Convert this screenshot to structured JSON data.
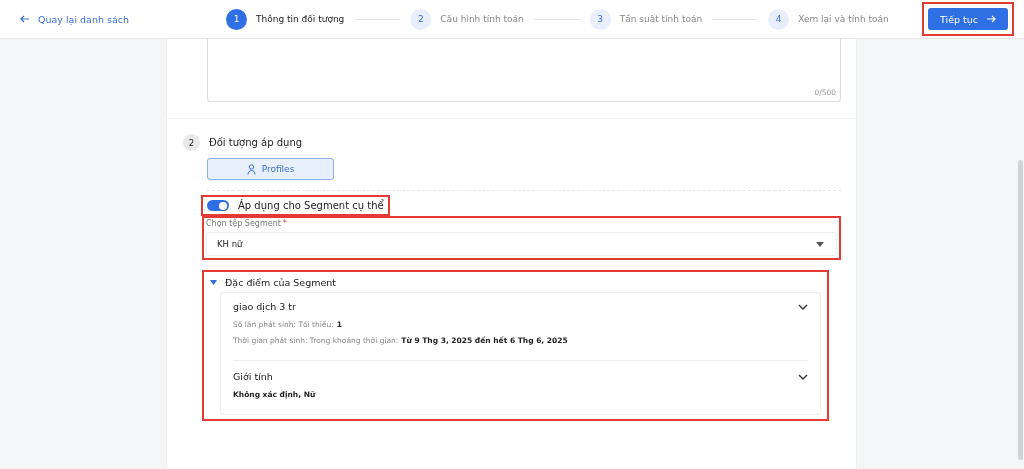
{
  "header": {
    "back_link": "Quay lại danh sách",
    "steps": [
      {
        "number": "1",
        "label": "Thông tin đối tượng",
        "selected": true
      },
      {
        "number": "2",
        "label": "Cấu hình tính toán",
        "selected": false
      },
      {
        "number": "3",
        "label": "Tần suất tính toán",
        "selected": false
      },
      {
        "number": "4",
        "label": "Xem lại và tính toán",
        "selected": false
      }
    ],
    "next_button": {
      "label": "Tiếp tục",
      "highlighted": true
    }
  },
  "description": {
    "counter": "0/500"
  },
  "section": {
    "number": "2",
    "title": "Đối tượng áp dụng",
    "profiles_button": {
      "label": "Profiles",
      "selected": true
    },
    "segment_toggle": {
      "label": "Áp dụng cho Segment cụ thể",
      "on": true,
      "highlighted": true
    },
    "segment_select": {
      "label": "Chọn tệp Segment",
      "required_mark": "*",
      "value": "KH nữ",
      "highlighted": true
    },
    "characteristics": {
      "title": "Đặc điểm của Segment",
      "expanded": true,
      "highlighted": true,
      "items": [
        {
          "title": "giao dịch 3 tr",
          "lines": [
            {
              "label": "Số lần phát sinh: Tối thiểu:",
              "value": "1"
            },
            {
              "label": "Thời gian phát sinh: Trong khoảng thời gian:",
              "value": "Từ 9 Thg 3, 2025 đến hết 6 Thg 6, 2025"
            }
          ]
        },
        {
          "title": "Giới tính",
          "lines": [
            {
              "value": "Không xác định, Nữ"
            }
          ]
        }
      ]
    }
  }
}
